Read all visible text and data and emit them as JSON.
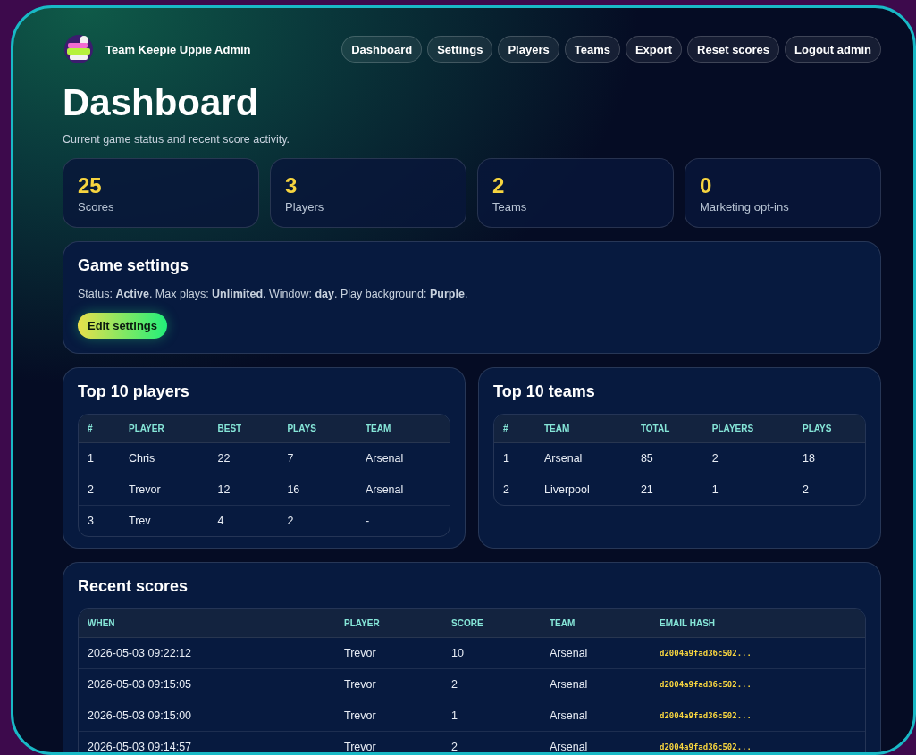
{
  "brand": {
    "title": "Team Keepie Uppie Admin"
  },
  "nav": [
    {
      "label": "Dashboard"
    },
    {
      "label": "Settings"
    },
    {
      "label": "Players"
    },
    {
      "label": "Teams"
    },
    {
      "label": "Export"
    },
    {
      "label": "Reset scores"
    },
    {
      "label": "Logout admin"
    }
  ],
  "page": {
    "title": "Dashboard",
    "subtitle": "Current game status and recent score activity."
  },
  "stats": [
    {
      "value": "25",
      "label": "Scores"
    },
    {
      "value": "3",
      "label": "Players"
    },
    {
      "value": "2",
      "label": "Teams"
    },
    {
      "value": "0",
      "label": "Marketing opt-ins"
    }
  ],
  "game_settings": {
    "title": "Game settings",
    "summary": "Status: **Active**. Max plays: **Unlimited**. Window: **day**. Play background: **Purple**.",
    "button": "Edit settings"
  },
  "top_players": {
    "title": "Top 10 players",
    "columns": [
      "#",
      "PLAYER",
      "BEST",
      "PLAYS",
      "TEAM"
    ],
    "rows": [
      [
        "1",
        "Chris",
        "22",
        "7",
        "Arsenal"
      ],
      [
        "2",
        "Trevor",
        "12",
        "16",
        "Arsenal"
      ],
      [
        "3",
        "Trev",
        "4",
        "2",
        "-"
      ]
    ]
  },
  "top_teams": {
    "title": "Top 10 teams",
    "columns": [
      "#",
      "TEAM",
      "TOTAL",
      "PLAYERS",
      "PLAYS"
    ],
    "rows": [
      [
        "1",
        "Arsenal",
        "85",
        "2",
        "18"
      ],
      [
        "2",
        "Liverpool",
        "21",
        "1",
        "2"
      ]
    ]
  },
  "recent_scores": {
    "title": "Recent scores",
    "columns": [
      "WHEN",
      "PLAYER",
      "SCORE",
      "TEAM",
      "EMAIL HASH"
    ],
    "rows": [
      [
        "2026-05-03 09:22:12",
        "Trevor",
        "10",
        "Arsenal",
        "d2004a9fad36c502..."
      ],
      [
        "2026-05-03 09:15:05",
        "Trevor",
        "2",
        "Arsenal",
        "d2004a9fad36c502..."
      ],
      [
        "2026-05-03 09:15:00",
        "Trevor",
        "1",
        "Arsenal",
        "d2004a9fad36c502..."
      ],
      [
        "2026-05-03 09:14:57",
        "Trevor",
        "2",
        "Arsenal",
        "d2004a9fad36c502..."
      ]
    ]
  }
}
